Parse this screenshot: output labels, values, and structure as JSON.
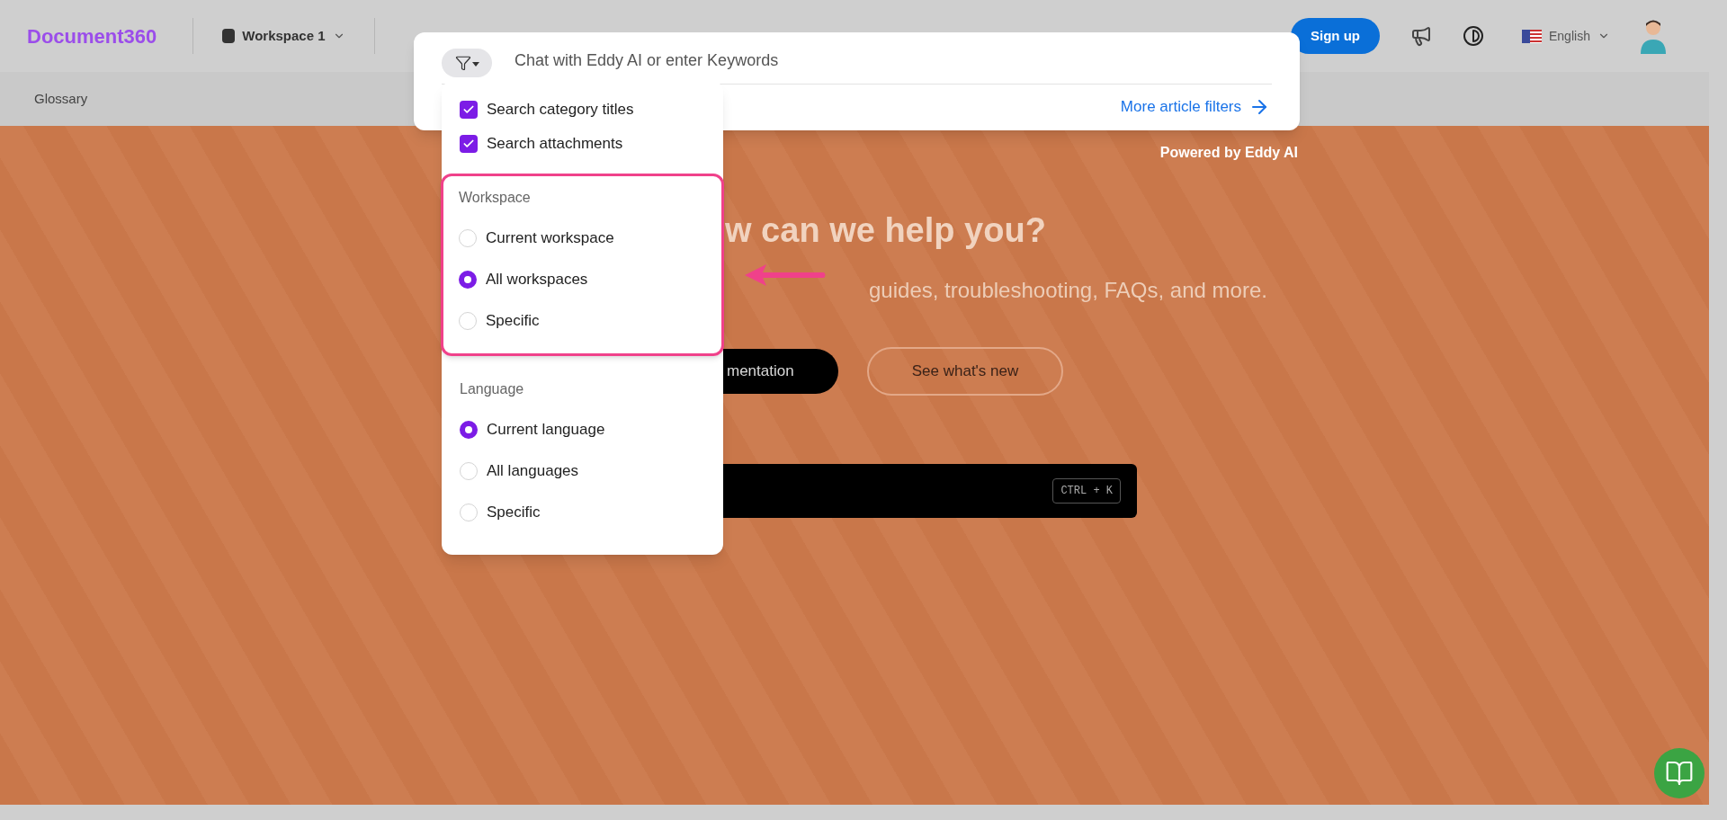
{
  "top_bar": {
    "logo": "Document360",
    "workspace": "Workspace 1",
    "sign_up": "Sign up",
    "language": "English"
  },
  "sub_bar": {
    "item": "Glossary"
  },
  "hero": {
    "heading": "w can we help you?",
    "subtitle": "guides, troubleshooting, FAQs, and more.",
    "primary_button": "mentation",
    "secondary_button": "See what's new",
    "shortcut": "CTRL + K"
  },
  "search": {
    "placeholder": "Chat with Eddy AI or enter Keywords",
    "more_filters": "More article filters",
    "powered_by": "Powered by Eddy AI"
  },
  "filter_menu": {
    "checkboxes": [
      {
        "label": "Search category titles",
        "checked": true
      },
      {
        "label": "Search attachments",
        "checked": true
      }
    ],
    "sections": [
      {
        "title": "Workspace",
        "highlighted": true,
        "options": [
          {
            "label": "Current workspace",
            "selected": false
          },
          {
            "label": "All workspaces",
            "selected": true
          },
          {
            "label": "Specific",
            "selected": false
          }
        ]
      },
      {
        "title": "Language",
        "highlighted": false,
        "options": [
          {
            "label": "Current language",
            "selected": true
          },
          {
            "label": "All languages",
            "selected": false
          },
          {
            "label": "Specific",
            "selected": false
          }
        ]
      }
    ]
  }
}
